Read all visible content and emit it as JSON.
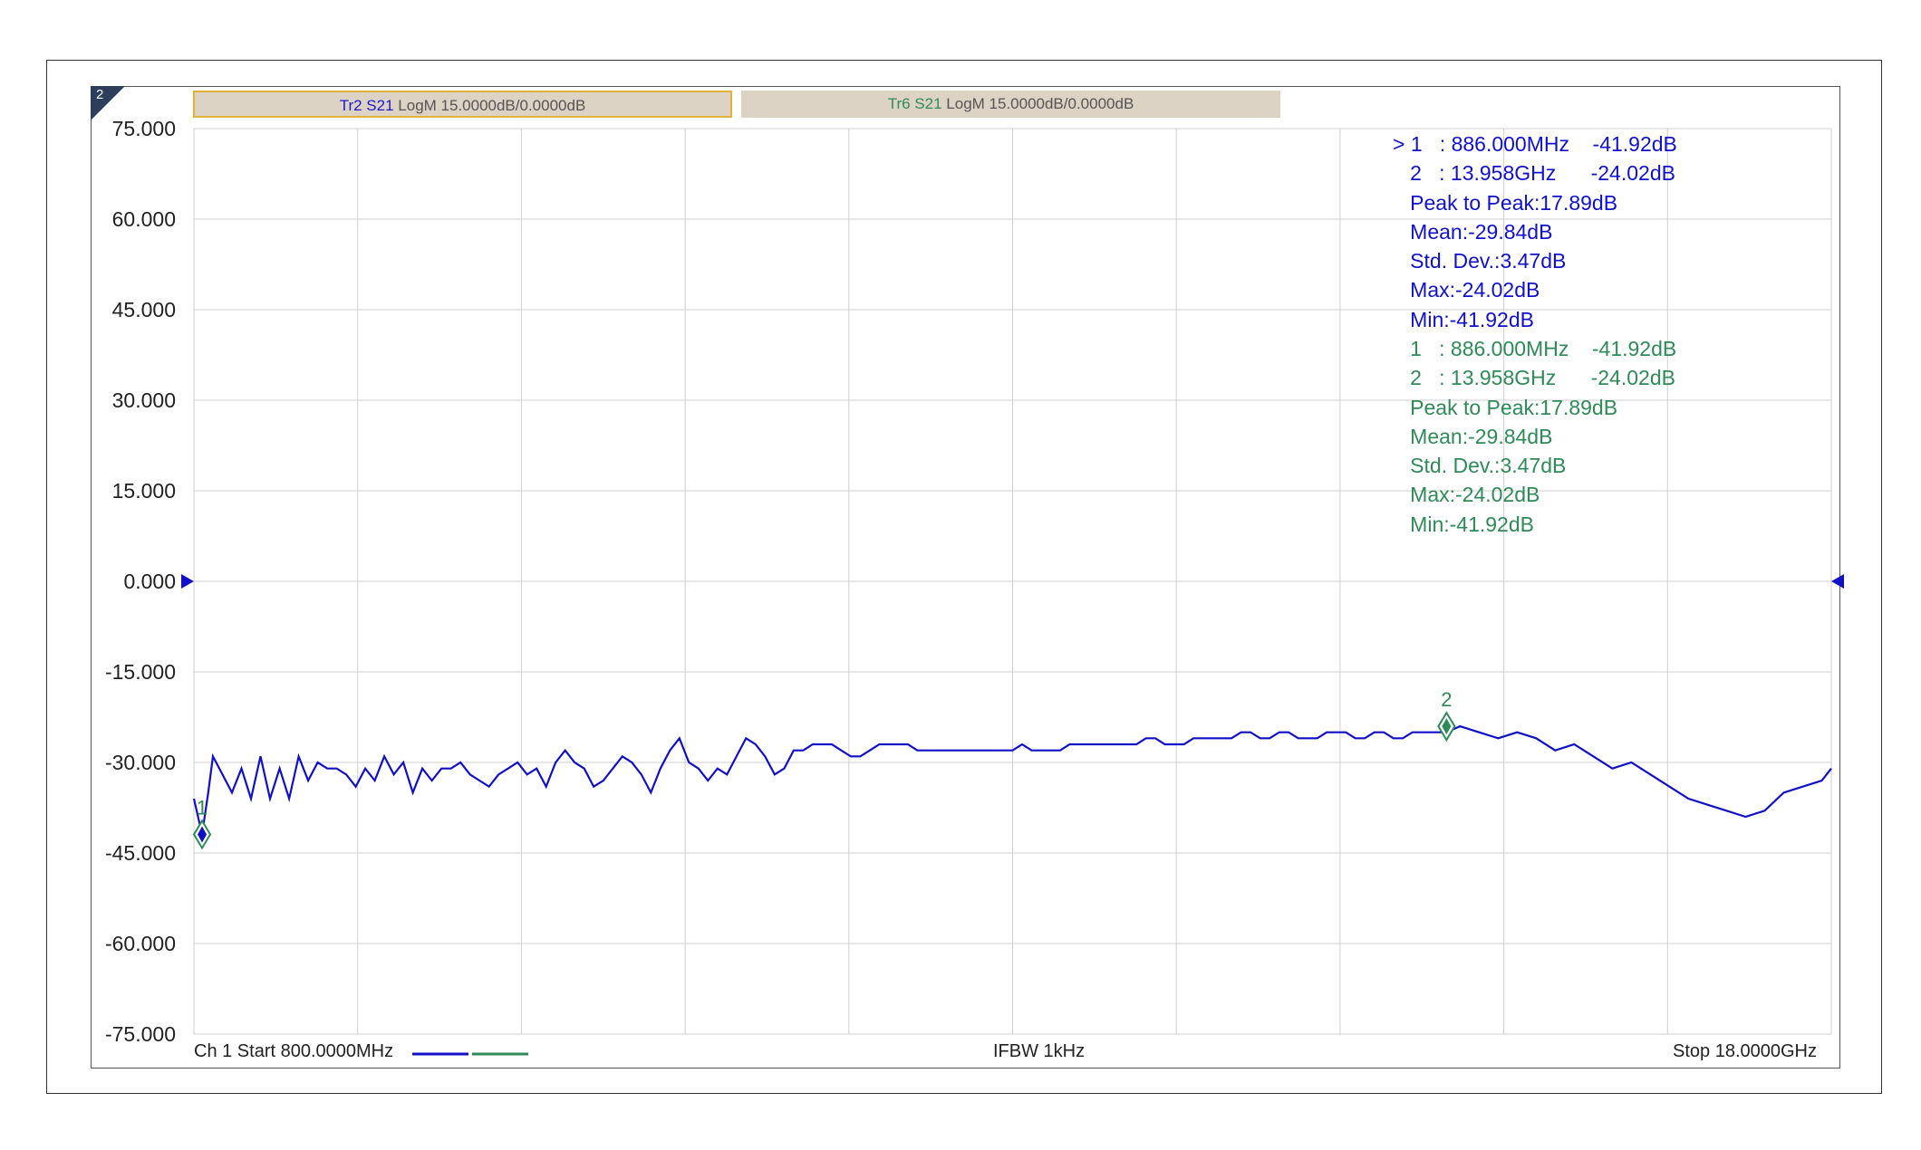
{
  "channel_badge": "2",
  "legend": {
    "tr2": {
      "name": "Tr2 S21",
      "rest": "LogM 15.0000dB/0.0000dB"
    },
    "tr6": {
      "name": "Tr6 S21",
      "rest": "LogM 15.0000dB/0.0000dB"
    }
  },
  "footer": {
    "start": "Ch 1 Start 800.0000MHz",
    "ifbw": "IFBW 1kHz",
    "stop": "Stop 18.0000GHz"
  },
  "readout_blue": [
    "> 1   : 886.000MHz    -41.92dB",
    "   2   : 13.958GHz      -24.02dB",
    "   Peak to Peak:17.89dB",
    "   Mean:-29.84dB",
    "   Std. Dev.:3.47dB",
    "   Max:-24.02dB",
    "   Min:-41.92dB"
  ],
  "readout_green": [
    "   1   : 886.000MHz    -41.92dB",
    "   2   : 13.958GHz      -24.02dB",
    "   Peak to Peak:17.89dB",
    "   Mean:-29.84dB",
    "   Std. Dev.:3.47dB",
    "   Max:-24.02dB",
    "   Min:-41.92dB"
  ],
  "colors": {
    "trace_blue": "#1010c8",
    "trace_green": "#2e8b57",
    "grid": "#cfcfcf"
  },
  "chart_data": {
    "type": "line",
    "y_tick_labels": [
      "75.000",
      "60.000",
      "45.000",
      "30.000",
      "15.000",
      "0.000",
      "-15.000",
      "-30.000",
      "-45.000",
      "-60.000",
      "-75.000"
    ],
    "ylim": [
      -75,
      75
    ],
    "xlim_ghz": [
      0.8,
      18.0
    ],
    "grid": true,
    "reference_level": 0,
    "series": [
      {
        "name": "Tr2 S21",
        "x_ghz": [
          0.8,
          0.886,
          0.95,
          1.0,
          1.1,
          1.2,
          1.3,
          1.4,
          1.5,
          1.6,
          1.7,
          1.8,
          1.9,
          2.0,
          2.1,
          2.2,
          2.3,
          2.4,
          2.5,
          2.6,
          2.7,
          2.8,
          2.9,
          3.0,
          3.1,
          3.2,
          3.3,
          3.4,
          3.5,
          3.6,
          3.7,
          3.8,
          3.9,
          4.0,
          4.1,
          4.2,
          4.3,
          4.4,
          4.5,
          4.6,
          4.7,
          4.8,
          4.9,
          5.0,
          5.1,
          5.2,
          5.3,
          5.4,
          5.5,
          5.6,
          5.7,
          5.8,
          5.9,
          6.0,
          6.1,
          6.2,
          6.3,
          6.4,
          6.5,
          6.6,
          6.7,
          6.8,
          6.9,
          7.0,
          7.1,
          7.2,
          7.3,
          7.4,
          7.5,
          7.6,
          7.7,
          7.8,
          7.9,
          8.0,
          8.1,
          8.2,
          8.3,
          8.4,
          8.5,
          8.6,
          8.7,
          8.8,
          8.9,
          9.0,
          9.1,
          9.2,
          9.3,
          9.4,
          9.5,
          9.6,
          9.7,
          9.8,
          9.9,
          10.0,
          10.1,
          10.2,
          10.3,
          10.4,
          10.5,
          10.6,
          10.7,
          10.8,
          10.9,
          11.0,
          11.1,
          11.2,
          11.3,
          11.4,
          11.5,
          11.6,
          11.7,
          11.8,
          11.9,
          12.0,
          12.1,
          12.2,
          12.3,
          12.4,
          12.5,
          12.6,
          12.7,
          12.8,
          12.9,
          13.0,
          13.1,
          13.2,
          13.3,
          13.4,
          13.5,
          13.6,
          13.7,
          13.8,
          13.958,
          14.1,
          14.3,
          14.5,
          14.7,
          14.9,
          15.1,
          15.3,
          15.5,
          15.7,
          15.9,
          16.1,
          16.3,
          16.5,
          16.7,
          16.9,
          17.1,
          17.3,
          17.5,
          17.7,
          17.9,
          18.0
        ],
        "y_db": [
          -36,
          -41.92,
          -35,
          -29,
          -32,
          -35,
          -31,
          -36,
          -29,
          -36,
          -31,
          -36,
          -29,
          -33,
          -30,
          -31,
          -31,
          -32,
          -34,
          -31,
          -33,
          -29,
          -32,
          -30,
          -35,
          -31,
          -33,
          -31,
          -31,
          -30,
          -32,
          -33,
          -34,
          -32,
          -31,
          -30,
          -32,
          -31,
          -34,
          -30,
          -28,
          -30,
          -31,
          -34,
          -33,
          -31,
          -29,
          -30,
          -32,
          -35,
          -31,
          -28,
          -26,
          -30,
          -31,
          -33,
          -31,
          -32,
          -29,
          -26,
          -27,
          -29,
          -32,
          -31,
          -28,
          -28,
          -27,
          -27,
          -27,
          -28,
          -29,
          -29,
          -28,
          -27,
          -27,
          -27,
          -27,
          -28,
          -28,
          -28,
          -28,
          -28,
          -28,
          -28,
          -28,
          -28,
          -28,
          -28,
          -27,
          -28,
          -28,
          -28,
          -28,
          -27,
          -27,
          -27,
          -27,
          -27,
          -27,
          -27,
          -27,
          -26,
          -26,
          -27,
          -27,
          -27,
          -26,
          -26,
          -26,
          -26,
          -26,
          -25,
          -25,
          -26,
          -26,
          -25,
          -25,
          -26,
          -26,
          -26,
          -25,
          -25,
          -25,
          -26,
          -26,
          -25,
          -25,
          -26,
          -26,
          -25,
          -25,
          -25,
          -25,
          -24.02,
          -25,
          -26,
          -25,
          -26,
          -28,
          -27,
          -29,
          -31,
          -30,
          -32,
          -34,
          -36,
          -37,
          -38,
          -39,
          -38,
          -35,
          -34,
          -33,
          -31
        ],
        "color": "#1010c8"
      }
    ],
    "markers": [
      {
        "label": "1",
        "x_ghz": 0.886,
        "y_db": -41.92
      },
      {
        "label": "2",
        "x_ghz": 13.958,
        "y_db": -24.02
      }
    ]
  }
}
